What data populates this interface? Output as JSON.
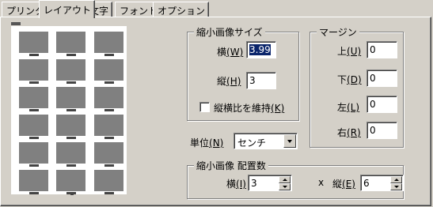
{
  "tabs": [
    {
      "label": "プリンタ",
      "active": false
    },
    {
      "label": "レイアウト",
      "active": true
    },
    {
      "label": "文字",
      "active": false
    },
    {
      "label": "フォント",
      "active": false
    },
    {
      "label": "オプション",
      "active": false
    }
  ],
  "thumbnail_size": {
    "title": "縮小画像サイズ",
    "width_label": "横",
    "width_mnemonic": "(W)",
    "width_value": "3.99",
    "height_label": "縦",
    "height_mnemonic": "(H)",
    "height_value": "3",
    "keep_ratio_label": "縦横比を維持",
    "keep_ratio_mnemonic": "(K)",
    "keep_ratio_checked": false
  },
  "margin": {
    "title": "マージン",
    "top_label": "上",
    "top_mnemonic": "(U)",
    "top_value": "0",
    "bottom_label": "下",
    "bottom_mnemonic": "(D)",
    "bottom_value": "0",
    "left_label": "左",
    "left_mnemonic": "(L)",
    "left_value": "0",
    "right_label": "右",
    "right_mnemonic": "(R)",
    "right_value": "0"
  },
  "unit": {
    "label": "単位",
    "mnemonic": "(N)",
    "value": "センチ"
  },
  "arrangement": {
    "title": "縮小画像 配置数",
    "cols_label": "横",
    "cols_mnemonic": "(I)",
    "cols_value": "3",
    "times": "x",
    "rows_label": "縦",
    "rows_mnemonic": "(E)",
    "rows_value": "6"
  },
  "preview": {
    "columns": 3,
    "rows": 6
  }
}
